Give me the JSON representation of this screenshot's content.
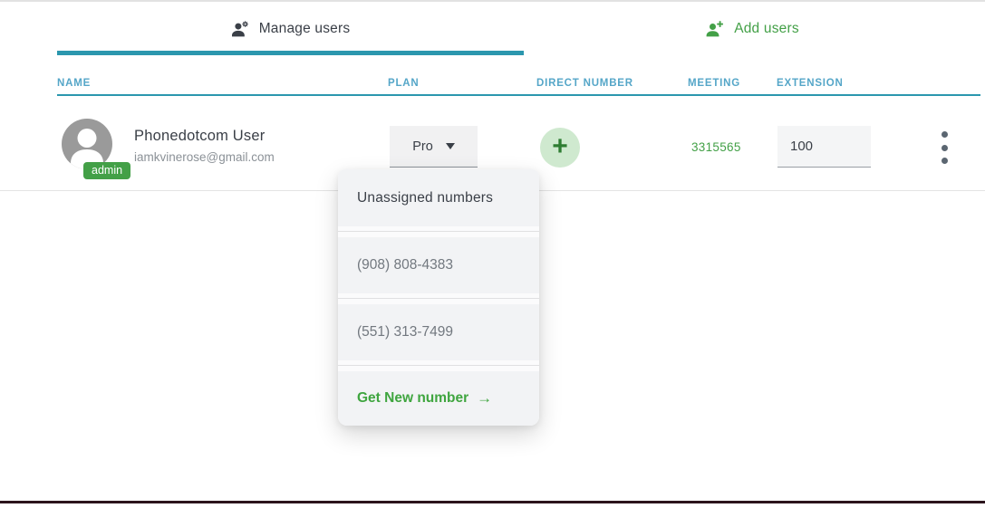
{
  "tabs": {
    "manage": {
      "label": "Manage users",
      "icon": "person-gear-icon"
    },
    "add": {
      "label": "Add users",
      "icon": "person-plus-icon"
    }
  },
  "table": {
    "headers": {
      "name": "NAME",
      "plan": "PLAN",
      "direct_number": "DIRECT NUMBER",
      "meeting": "MEETING",
      "extension": "EXTENSION"
    }
  },
  "user": {
    "name": "Phonedotcom User",
    "email": "iamkvinerose@gmail.com",
    "role_badge": "admin",
    "plan": "Pro",
    "meeting": "3315565",
    "extension": "100"
  },
  "dropdown": {
    "header": "Unassigned numbers",
    "numbers": [
      "(908) 808-4383",
      "(551) 313-7499"
    ],
    "action_label": "Get New number",
    "action_arrow": "→"
  },
  "icons": {
    "plus": "+"
  },
  "colors": {
    "accent_teal": "#2b97ae",
    "header_blue": "#55a6c8",
    "green": "#43a047",
    "dark_text": "#3a3f47",
    "gray_text": "#72787f",
    "bottom_bar": "#2b141c"
  }
}
